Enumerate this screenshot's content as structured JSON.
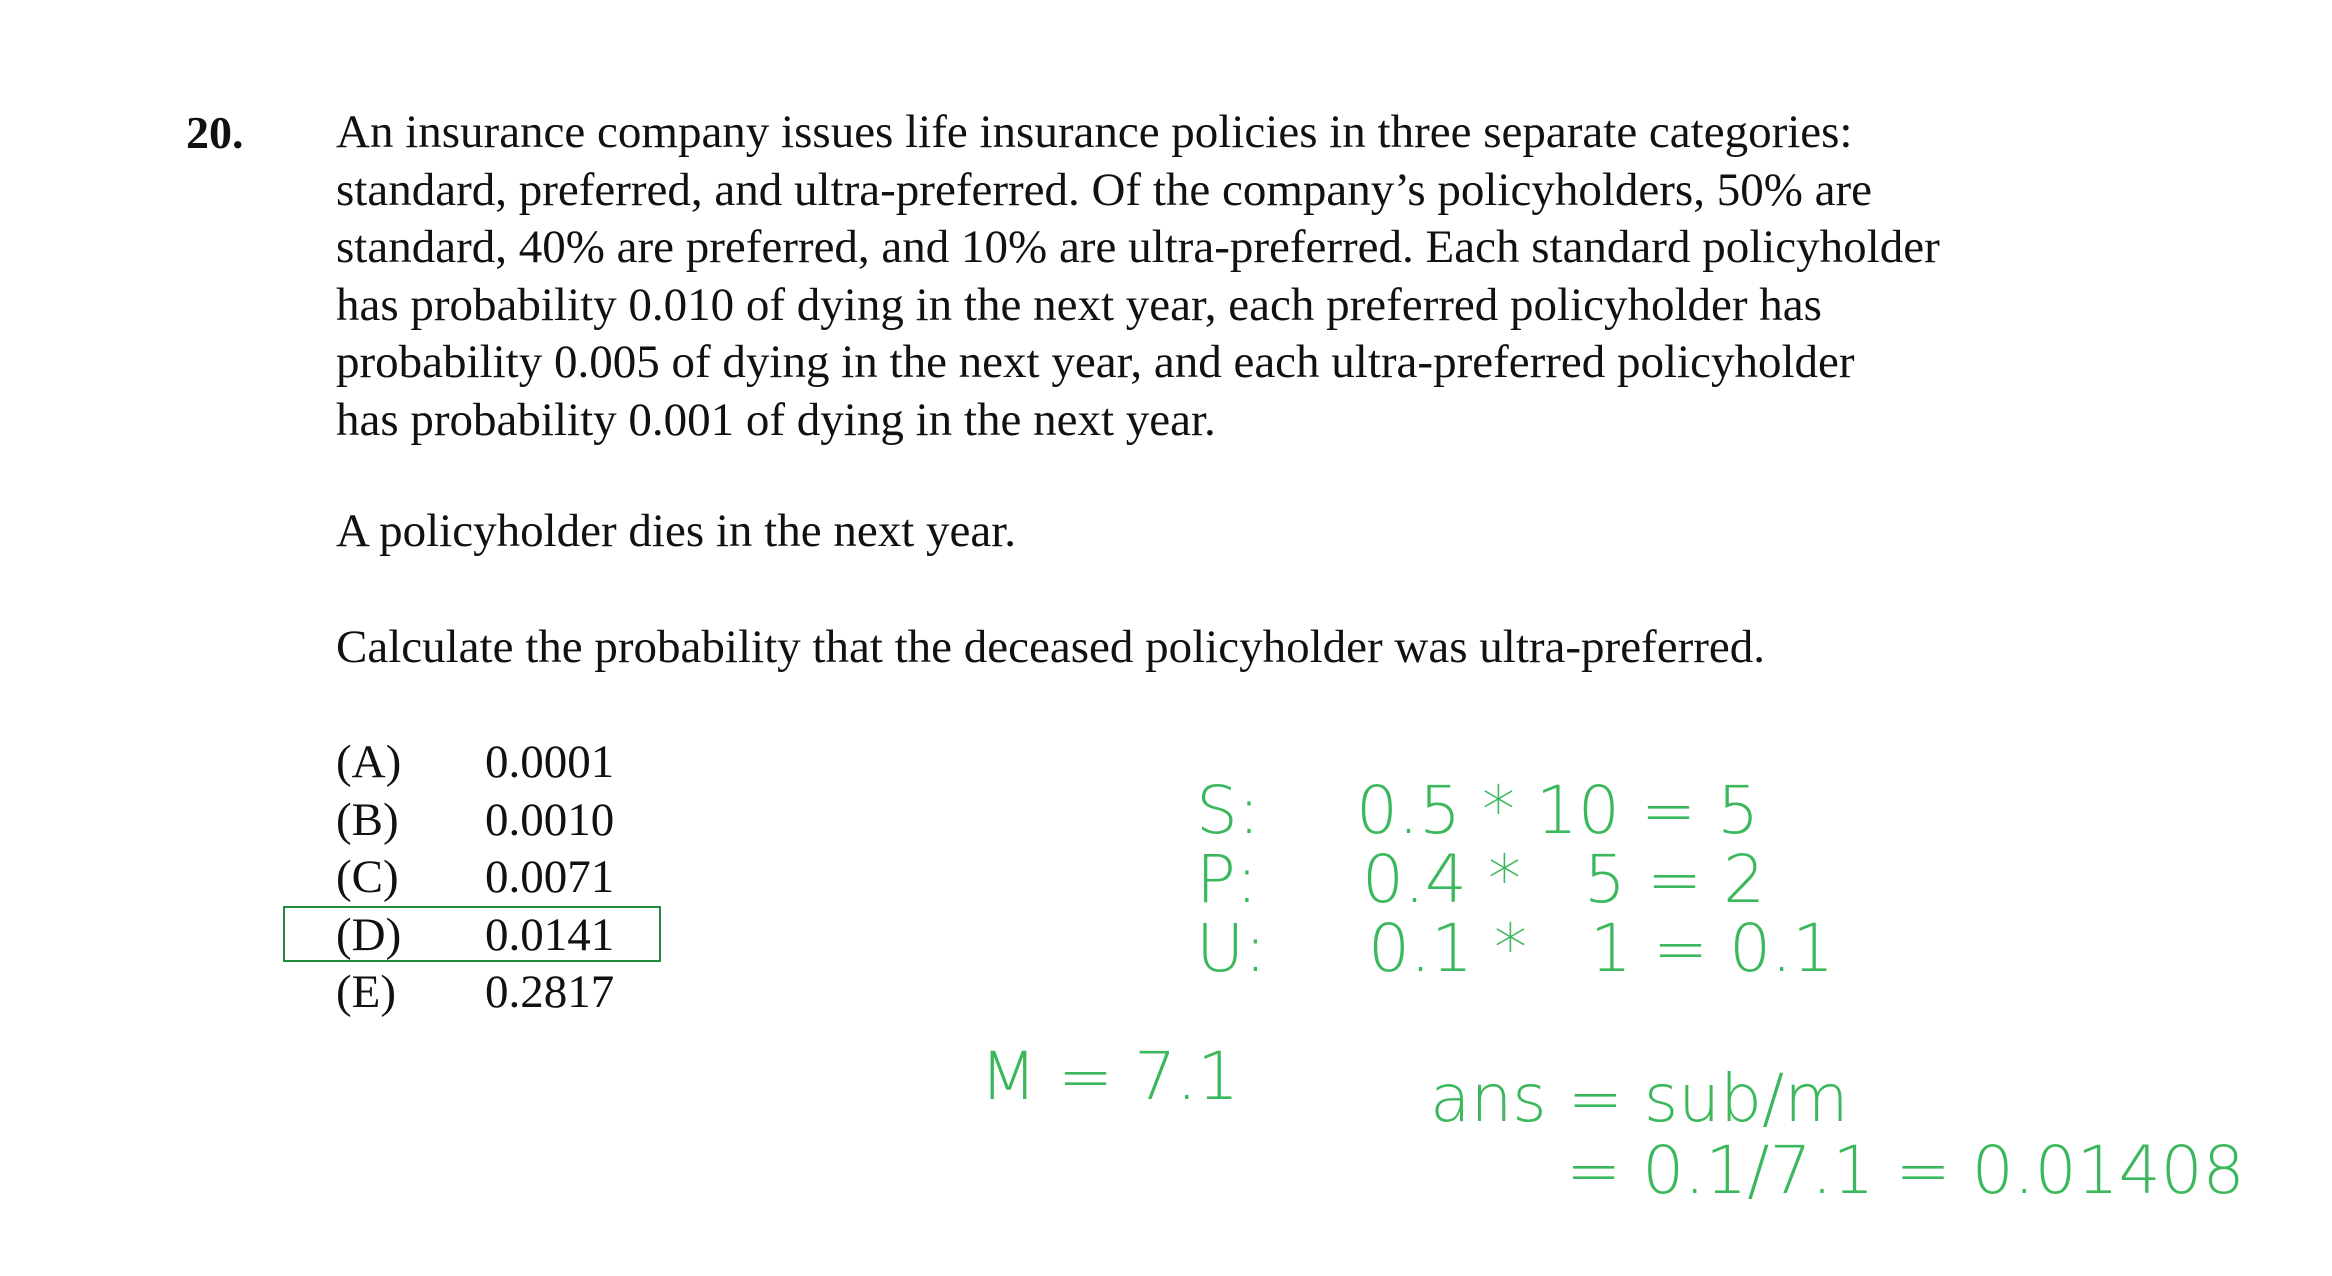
{
  "question": {
    "number": "20.",
    "paragraph_lines": [
      "An insurance company issues life insurance policies in three separate categories:",
      "standard, preferred, and ultra-preferred.  Of the company’s policyholders, 50% are",
      "standard, 40% are preferred, and 10% are ultra-preferred.  Each standard policyholder",
      "has probability 0.010 of dying in the next year, each preferred policyholder has",
      "probability 0.005 of dying in the next year, and each ultra-preferred policyholder",
      "has probability 0.001 of dying in the next year."
    ],
    "event": "A policyholder dies in the next year.",
    "prompt": "Calculate the probability that the deceased policyholder was ultra-preferred."
  },
  "options": [
    {
      "letter": "(A)",
      "value": "0.0001"
    },
    {
      "letter": "(B)",
      "value": "0.0010"
    },
    {
      "letter": "(C)",
      "value": "0.0071"
    },
    {
      "letter": "(D)",
      "value": "0.0141"
    },
    {
      "letter": "(E)",
      "value": "0.2817"
    }
  ],
  "selected_option": "(D)",
  "handwriting": {
    "color": "#3cb85c",
    "s_label": "S:",
    "p_label": "P:",
    "u_label": "U:",
    "s_calc": "0.5 * 10 = 5",
    "p_calc": "0.4 *   5 = 2",
    "u_calc": "0.1 *   1 = 0.1",
    "m_line": "M = 7.1",
    "ans_line": "ans = sub/m",
    "result_line": "= 0.1/7.1 = 0.01408"
  }
}
